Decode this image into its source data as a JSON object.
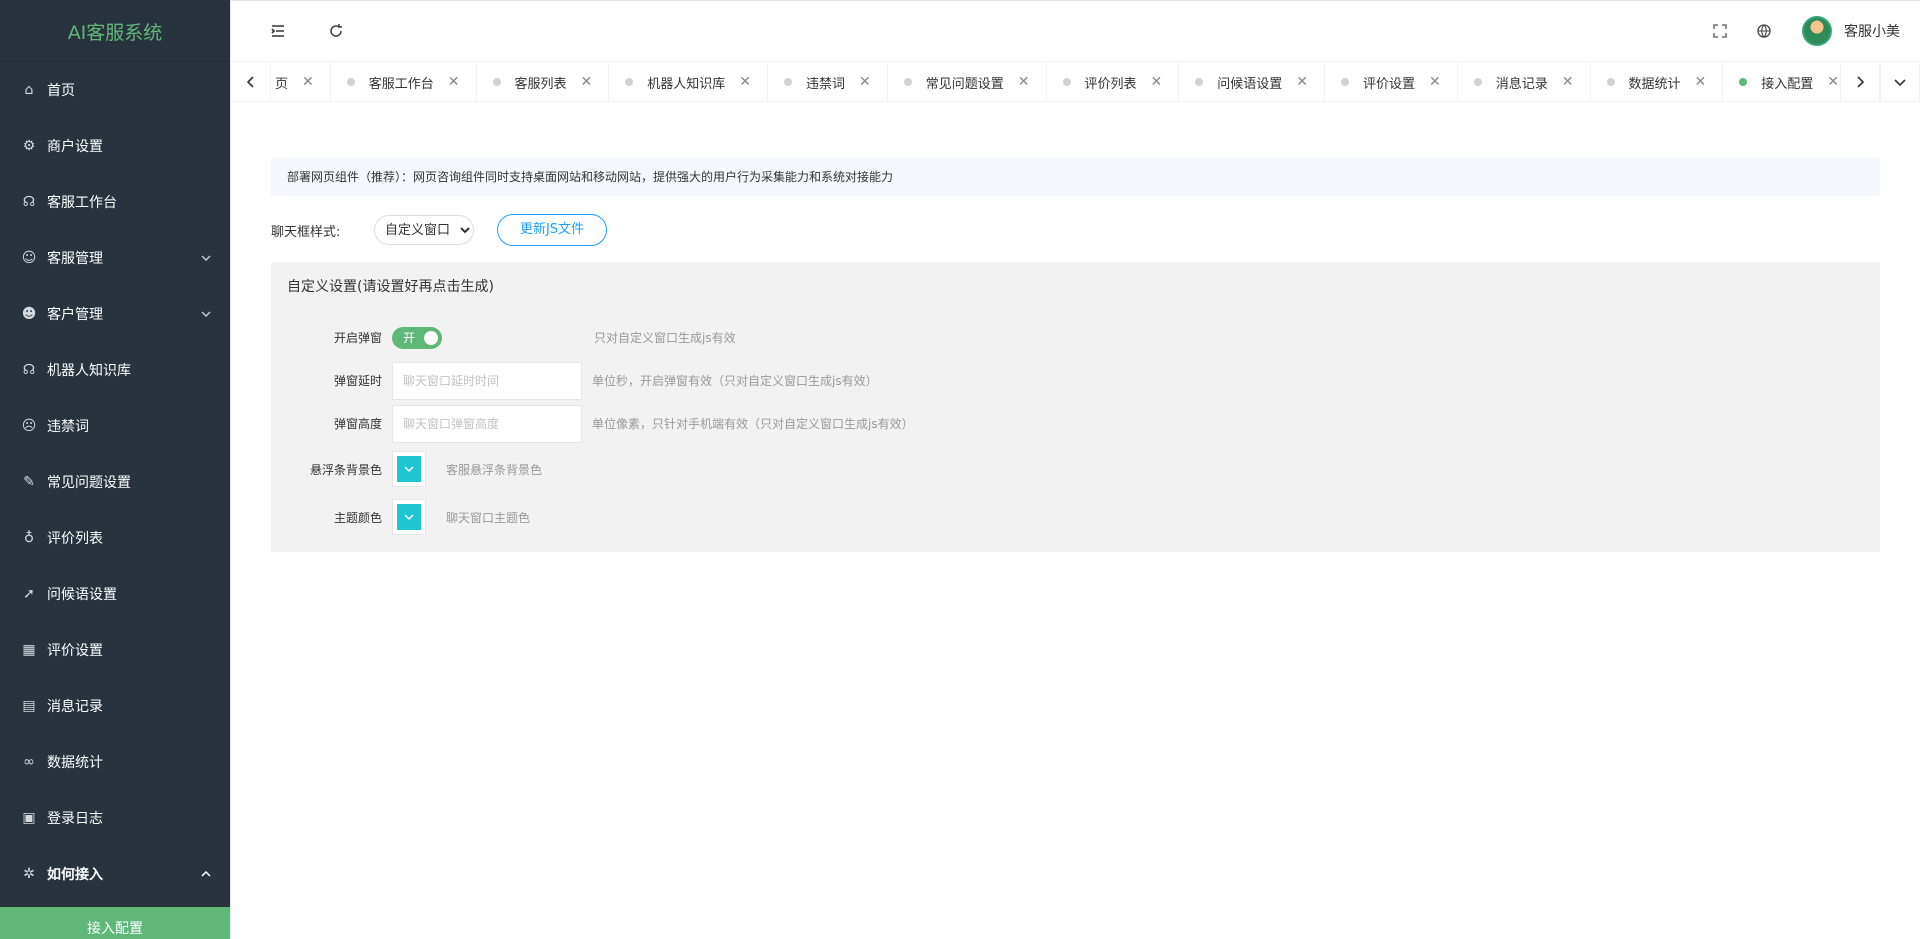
{
  "app": {
    "title": "AI客服系统"
  },
  "sidebar": {
    "items": [
      {
        "label": "首页",
        "icon": "home-icon",
        "glyph": "⌂"
      },
      {
        "label": "商户设置",
        "icon": "gear-icon",
        "glyph": "⚙"
      },
      {
        "label": "客服工作台",
        "icon": "headset-icon",
        "glyph": "☊"
      },
      {
        "label": "客服管理",
        "icon": "user-icon",
        "glyph": "☺"
      },
      {
        "label": "客户管理",
        "icon": "user-group-icon",
        "glyph": "☻"
      },
      {
        "label": "机器人知识库",
        "icon": "robot-icon",
        "glyph": "☊"
      },
      {
        "label": "违禁词",
        "icon": "face-icon",
        "glyph": "☹"
      },
      {
        "label": "常见问题设置",
        "icon": "edit-icon",
        "glyph": "✎"
      },
      {
        "label": "评价列表",
        "icon": "thumb-up-icon",
        "glyph": "♁"
      },
      {
        "label": "问候语设置",
        "icon": "send-icon",
        "glyph": "➚"
      },
      {
        "label": "评价设置",
        "icon": "calendar-icon",
        "glyph": "▦"
      },
      {
        "label": "消息记录",
        "icon": "file-icon",
        "glyph": "▤"
      },
      {
        "label": "数据统计",
        "icon": "chart-icon",
        "glyph": "∞"
      },
      {
        "label": "登录日志",
        "icon": "log-icon",
        "glyph": "▣"
      },
      {
        "label": "如何接入",
        "icon": "plugin-icon",
        "glyph": "✲"
      }
    ],
    "submenu_active": "接入配置"
  },
  "header": {
    "user_name": "客服小美"
  },
  "tabs": [
    {
      "label": "页",
      "active": false,
      "first": true
    },
    {
      "label": "客服工作台",
      "active": false
    },
    {
      "label": "客服列表",
      "active": false
    },
    {
      "label": "机器人知识库",
      "active": false
    },
    {
      "label": "违禁词",
      "active": false
    },
    {
      "label": "常见问题设置",
      "active": false
    },
    {
      "label": "评价列表",
      "active": false
    },
    {
      "label": "问候语设置",
      "active": false
    },
    {
      "label": "评价设置",
      "active": false
    },
    {
      "label": "消息记录",
      "active": false
    },
    {
      "label": "数据统计",
      "active": false
    },
    {
      "label": "接入配置",
      "active": true
    }
  ],
  "content": {
    "notice": "部署网页组件（推荐）：网页咨询组件同时支持桌面网站和移动网站，提供强大的用户行为采集能力和系统对接能力",
    "style_label": "聊天框样式:",
    "style_selected": "自定义窗口",
    "update_button": "更新JS文件",
    "panel_title": "自定义设置(请设置好再点击生成)",
    "popup": {
      "label": "开启弹窗",
      "switch_text": "开",
      "hint": "只对自定义窗口生成js有效"
    },
    "delay": {
      "label": "弹窗延时",
      "placeholder": "聊天窗口延时时间",
      "hint": "单位秒，开启弹窗有效（只对自定义窗口生成js有效）"
    },
    "height": {
      "label": "弹窗高度",
      "placeholder": "聊天窗口弹窗高度",
      "hint": "单位像素，只针对手机端有效（只对自定义窗口生成js有效）"
    },
    "float_color": {
      "label": "悬浮条背景色",
      "hint": "客服悬浮条背景色",
      "value": "#1fc6cf"
    },
    "theme_color": {
      "label": "主题颜色",
      "hint": "聊天窗口主题色",
      "value": "#1fc6cf"
    }
  }
}
